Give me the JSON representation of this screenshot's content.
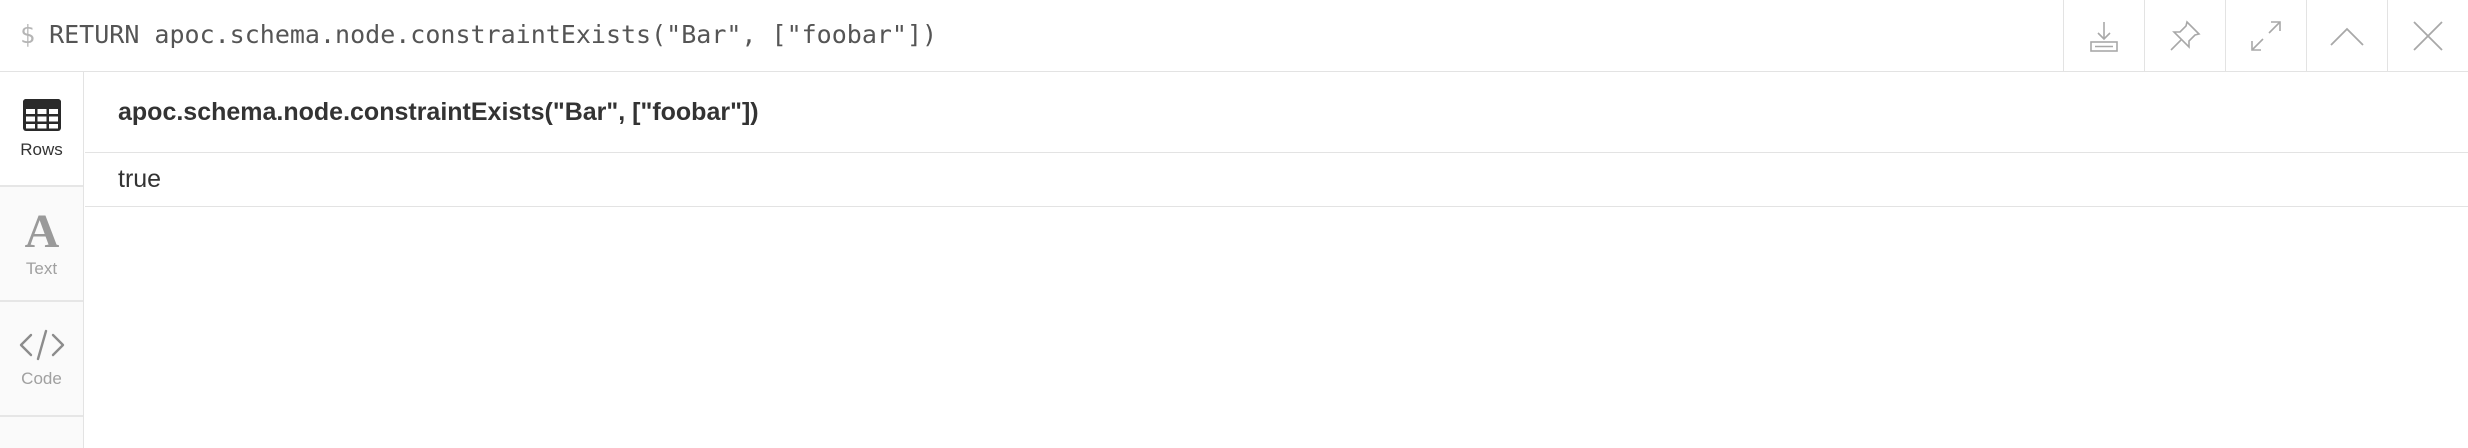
{
  "header": {
    "prompt": "$",
    "query": "RETURN apoc.schema.node.constraintExists(\"Bar\", [\"foobar\"])",
    "actions": [
      {
        "icon": "download-icon"
      },
      {
        "icon": "pin-icon"
      },
      {
        "icon": "expand-icon"
      },
      {
        "icon": "collapse-up-icon"
      },
      {
        "icon": "close-icon"
      }
    ]
  },
  "sidebar": {
    "items": [
      {
        "label": "Rows",
        "icon": "table-icon",
        "active": true
      },
      {
        "label": "Text",
        "icon": "text-a-icon",
        "active": false
      },
      {
        "label": "Code",
        "icon": "code-icon",
        "active": false
      }
    ]
  },
  "result": {
    "columns": [
      "apoc.schema.node.constraintExists(\"Bar\", [\"foobar\"])"
    ],
    "rows": [
      [
        "true"
      ]
    ]
  },
  "colors": {
    "border": "#e3e3e3",
    "icon": "#a8a8a8",
    "text": "#333333",
    "muted": "#a0a0a0"
  }
}
